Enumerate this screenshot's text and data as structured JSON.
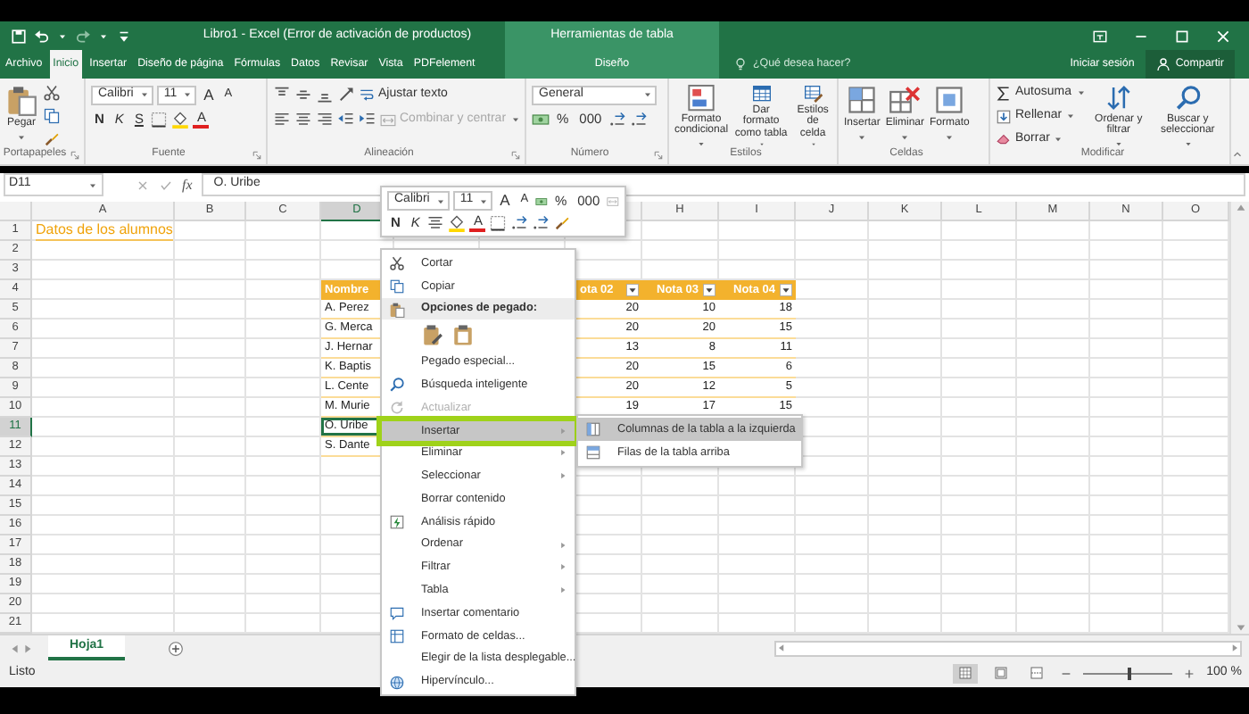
{
  "title_bar": {
    "title": "Libro1 - Excel (Error de activación de productos)",
    "context_group": "Herramientas de tabla"
  },
  "tabs": [
    {
      "label": "Archivo",
      "selected": false,
      "kind": "file"
    },
    {
      "label": "Inicio",
      "selected": true,
      "kind": "tab"
    },
    {
      "label": "Insertar",
      "selected": false,
      "kind": "tab"
    },
    {
      "label": "Diseño de página",
      "selected": false,
      "kind": "tab"
    },
    {
      "label": "Fórmulas",
      "selected": false,
      "kind": "tab"
    },
    {
      "label": "Datos",
      "selected": false,
      "kind": "tab"
    },
    {
      "label": "Revisar",
      "selected": false,
      "kind": "tab"
    },
    {
      "label": "Vista",
      "selected": false,
      "kind": "tab"
    },
    {
      "label": "PDFelement",
      "selected": false,
      "kind": "tab"
    },
    {
      "label": "Diseño",
      "selected": false,
      "kind": "context"
    }
  ],
  "tell_me": {
    "placeholder": "¿Qué desea hacer?"
  },
  "account": {
    "sign_in": "Iniciar sesión",
    "share": "Compartir"
  },
  "ribbon": [
    {
      "label": "Portapapeles",
      "launcher": true,
      "items": [
        {
          "kind": "large",
          "label": "Pegar",
          "dropdown": true
        },
        {
          "kind": "stack",
          "lines": [
            {
              "items": [
                {
                  "kind": "icon"
                }
              ]
            },
            {
              "items": [
                {
                  "kind": "icon"
                }
              ]
            },
            {
              "items": [
                {
                  "kind": "icon"
                }
              ]
            }
          ]
        }
      ]
    },
    {
      "label": "Fuente",
      "launcher": true,
      "items": [
        {
          "kind": "stack",
          "lines": [
            {
              "items": [
                {
                  "kind": "field",
                  "label": "Calibri"
                },
                {
                  "kind": "field",
                  "label": "11"
                },
                {
                  "kind": "grow-font",
                  "label": "A"
                },
                {
                  "kind": "shrink-font",
                  "label": "A"
                }
              ]
            },
            {
              "items": [
                {
                  "kind": "bold",
                  "label": "N"
                },
                {
                  "kind": "italic",
                  "label": "K"
                },
                {
                  "kind": "underline",
                  "label": "S"
                },
                {
                  "kind": "icon"
                },
                {
                  "kind": "icon"
                },
                {
                  "kind": "font-color",
                  "label": "A"
                }
              ]
            }
          ]
        }
      ]
    },
    {
      "label": "Alineación",
      "launcher": true,
      "items": [
        {
          "kind": "stack",
          "lines": [
            {
              "items": [
                {
                  "kind": "icon"
                },
                {
                  "kind": "icon"
                },
                {
                  "kind": "icon"
                },
                {
                  "kind": "icon"
                },
                {
                  "kind": "small",
                  "label": "Ajustar texto",
                  "disabled": false,
                  "dropdown": false
                }
              ]
            },
            {
              "items": [
                {
                  "kind": "icon"
                },
                {
                  "kind": "icon"
                },
                {
                  "kind": "icon"
                },
                {
                  "kind": "icon"
                },
                {
                  "kind": "icon"
                },
                {
                  "kind": "small",
                  "label": "Combinar y centrar",
                  "disabled": true,
                  "dropdown": true
                }
              ]
            }
          ]
        }
      ]
    },
    {
      "label": "Número",
      "launcher": true,
      "items": [
        {
          "kind": "stack",
          "lines": [
            {
              "items": [
                {
                  "kind": "field",
                  "label": "General",
                  "wide": true
                }
              ]
            },
            {
              "items": [
                {
                  "kind": "icon"
                },
                {
                  "kind": "number-format",
                  "label": "%"
                },
                {
                  "kind": "number-format",
                  "label": "000"
                },
                {
                  "kind": "icon"
                },
                {
                  "kind": "icon"
                }
              ]
            }
          ]
        }
      ]
    },
    {
      "label": "Estilos",
      "launcher": false,
      "items": [
        {
          "kind": "large",
          "label": "Formato condicional",
          "dropdown": true
        },
        {
          "kind": "large",
          "label": "Dar formato como tabla",
          "dropdown": true
        },
        {
          "kind": "large",
          "label": "Estilos de celda",
          "dropdown": true
        }
      ]
    },
    {
      "label": "Celdas",
      "launcher": false,
      "items": [
        {
          "kind": "large",
          "label": "Insertar",
          "dropdown": true
        },
        {
          "kind": "large",
          "label": "Eliminar",
          "dropdown": true
        },
        {
          "kind": "large",
          "label": "Formato",
          "dropdown": true
        }
      ]
    },
    {
      "label": "Modificar",
      "launcher": false,
      "items": [
        {
          "kind": "stack",
          "lines": [
            {
              "items": [
                {
                  "kind": "small",
                  "label": "Autosuma",
                  "disabled": false,
                  "dropdown": true
                }
              ]
            },
            {
              "items": [
                {
                  "kind": "small",
                  "label": "Rellenar",
                  "disabled": false,
                  "dropdown": true
                }
              ]
            },
            {
              "items": [
                {
                  "kind": "small",
                  "label": "Borrar",
                  "disabled": false,
                  "dropdown": true
                }
              ]
            }
          ]
        },
        {
          "kind": "large",
          "label": "Ordenar y filtrar",
          "dropdown": true
        },
        {
          "kind": "large",
          "label": "Buscar y seleccionar",
          "dropdown": true
        }
      ]
    }
  ],
  "formula_bar": {
    "name_box": "D11",
    "fx_label": "fx",
    "formula": "O. Uribe"
  },
  "sheet": {
    "columns": [
      {
        "label": "A",
        "selected": false
      },
      {
        "label": "B",
        "selected": false
      },
      {
        "label": "C",
        "selected": false
      },
      {
        "label": "D",
        "selected": true
      },
      {
        "label": "H",
        "selected": false
      },
      {
        "label": "I",
        "selected": false
      },
      {
        "label": "J",
        "selected": false
      },
      {
        "label": "K",
        "selected": false
      },
      {
        "label": "L",
        "selected": false
      },
      {
        "label": "M",
        "selected": false
      },
      {
        "label": "N",
        "selected": false
      },
      {
        "label": "O",
        "selected": false
      }
    ],
    "rows": [
      {
        "label": "1",
        "selected": false
      },
      {
        "label": "2",
        "selected": false
      },
      {
        "label": "3",
        "selected": false
      },
      {
        "label": "4",
        "selected": false
      },
      {
        "label": "5",
        "selected": false
      },
      {
        "label": "6",
        "selected": false
      },
      {
        "label": "7",
        "selected": false
      },
      {
        "label": "8",
        "selected": false
      },
      {
        "label": "9",
        "selected": false
      },
      {
        "label": "10",
        "selected": false
      },
      {
        "label": "11",
        "selected": true
      },
      {
        "label": "12",
        "selected": false
      },
      {
        "label": "13",
        "selected": false
      },
      {
        "label": "14",
        "selected": false
      },
      {
        "label": "15",
        "selected": false
      },
      {
        "label": "16",
        "selected": false
      },
      {
        "label": "17",
        "selected": false
      },
      {
        "label": "18",
        "selected": false
      },
      {
        "label": "19",
        "selected": false
      },
      {
        "label": "20",
        "selected": false
      },
      {
        "label": "21",
        "selected": false
      }
    ],
    "title_cell": "Datos de los alumnos",
    "table": {
      "name_column": {
        "header": "Nombre",
        "cells": [
          {
            "text": "A. Perez",
            "selected": false
          },
          {
            "text": "G. Merca",
            "selected": false
          },
          {
            "text": "J. Hernar",
            "selected": false
          },
          {
            "text": "K. Baptis",
            "selected": false
          },
          {
            "text": "L. Cente",
            "selected": false
          },
          {
            "text": "M. Murie",
            "selected": false
          },
          {
            "text": "O. Uribe",
            "selected": true
          },
          {
            "text": "S. Dante",
            "selected": false
          }
        ]
      },
      "value_columns": [
        {
          "header": "ota 02",
          "filter": true,
          "values": [
            "20",
            "20",
            "13",
            "20",
            "20",
            "19"
          ]
        },
        {
          "header": "Nota 03",
          "filter": true,
          "values": [
            "10",
            "20",
            "8",
            "15",
            "12",
            "17"
          ]
        },
        {
          "header": "Nota 04",
          "filter": true,
          "values": [
            "18",
            "15",
            "11",
            "6",
            "5",
            "15"
          ]
        }
      ]
    }
  },
  "mini_toolbar": {
    "lines": [
      {
        "items": [
          {
            "kind": "field",
            "label": "Calibri"
          },
          {
            "kind": "field",
            "label": "11"
          },
          {
            "kind": "grow-font",
            "label": "A"
          },
          {
            "kind": "shrink-font",
            "label": "A"
          },
          {
            "kind": "icon"
          },
          {
            "kind": "number-format",
            "label": "%"
          },
          {
            "kind": "number-format",
            "label": "000"
          },
          {
            "kind": "icon"
          }
        ]
      },
      {
        "items": [
          {
            "kind": "bold",
            "label": "N"
          },
          {
            "kind": "italic",
            "label": "K"
          },
          {
            "kind": "icon"
          },
          {
            "kind": "icon"
          },
          {
            "kind": "font-color",
            "label": "A"
          },
          {
            "kind": "icon"
          },
          {
            "kind": "icon"
          },
          {
            "kind": "icon"
          },
          {
            "kind": "icon"
          }
        ]
      }
    ]
  },
  "context_menu": [
    {
      "kind": "item",
      "label": "Cortar",
      "has_icon": true,
      "disabled": false,
      "submenu": false,
      "selected": false,
      "annotated": false
    },
    {
      "kind": "item",
      "label": "Copiar",
      "has_icon": true,
      "disabled": false,
      "submenu": false,
      "selected": false,
      "annotated": false
    },
    {
      "kind": "header",
      "label": "Opciones de pegado:",
      "has_icon": true,
      "disabled": false,
      "submenu": false,
      "selected": false,
      "annotated": false
    },
    {
      "kind": "paste-options"
    },
    {
      "kind": "item",
      "label": "Pegado especial...",
      "has_icon": false,
      "disabled": false,
      "submenu": false,
      "selected": false,
      "annotated": false
    },
    {
      "kind": "item",
      "label": "Búsqueda inteligente",
      "has_icon": true,
      "disabled": false,
      "submenu": false,
      "selected": false,
      "annotated": false
    },
    {
      "kind": "item",
      "label": "Actualizar",
      "has_icon": true,
      "disabled": true,
      "submenu": false,
      "selected": false,
      "annotated": false
    },
    {
      "kind": "item",
      "label": "Insertar",
      "has_icon": false,
      "disabled": false,
      "submenu": true,
      "selected": true,
      "annotated": true
    },
    {
      "kind": "item",
      "label": "Eliminar",
      "has_icon": false,
      "disabled": false,
      "submenu": true,
      "selected": false,
      "annotated": false
    },
    {
      "kind": "item",
      "label": "Seleccionar",
      "has_icon": false,
      "disabled": false,
      "submenu": true,
      "selected": false,
      "annotated": false
    },
    {
      "kind": "item",
      "label": "Borrar contenido",
      "has_icon": false,
      "disabled": false,
      "submenu": false,
      "selected": false,
      "annotated": false
    },
    {
      "kind": "item",
      "label": "Análisis rápido",
      "has_icon": true,
      "disabled": false,
      "submenu": false,
      "selected": false,
      "annotated": false
    },
    {
      "kind": "item",
      "label": "Ordenar",
      "has_icon": false,
      "disabled": false,
      "submenu": true,
      "selected": false,
      "annotated": false
    },
    {
      "kind": "item",
      "label": "Filtrar",
      "has_icon": false,
      "disabled": false,
      "submenu": true,
      "selected": false,
      "annotated": false
    },
    {
      "kind": "item",
      "label": "Tabla",
      "has_icon": false,
      "disabled": false,
      "submenu": true,
      "selected": false,
      "annotated": false
    },
    {
      "kind": "item",
      "label": "Insertar comentario",
      "has_icon": true,
      "disabled": false,
      "submenu": false,
      "selected": false,
      "annotated": false
    },
    {
      "kind": "item",
      "label": "Formato de celdas...",
      "has_icon": true,
      "disabled": false,
      "submenu": false,
      "selected": false,
      "annotated": false
    },
    {
      "kind": "item",
      "label": "Elegir de la lista desplegable...",
      "has_icon": false,
      "disabled": false,
      "submenu": false,
      "selected": false,
      "annotated": false
    },
    {
      "kind": "item",
      "label": "Hipervínculo...",
      "has_icon": true,
      "disabled": false,
      "submenu": false,
      "selected": false,
      "annotated": false
    }
  ],
  "submenu": [
    {
      "label": "Columnas de la tabla a la izquierda",
      "selected": true
    },
    {
      "label": "Filas de la tabla arriba",
      "selected": false
    }
  ],
  "sheet_tabs": [
    {
      "label": "Hoja1",
      "selected": true
    }
  ],
  "status_bar": {
    "text": "Listo",
    "views": [
      {
        "selected": true
      },
      {
        "selected": false
      },
      {
        "selected": false
      }
    ],
    "zoom": {
      "level": 0.5
    },
    "zoom_label": "100 %"
  }
}
